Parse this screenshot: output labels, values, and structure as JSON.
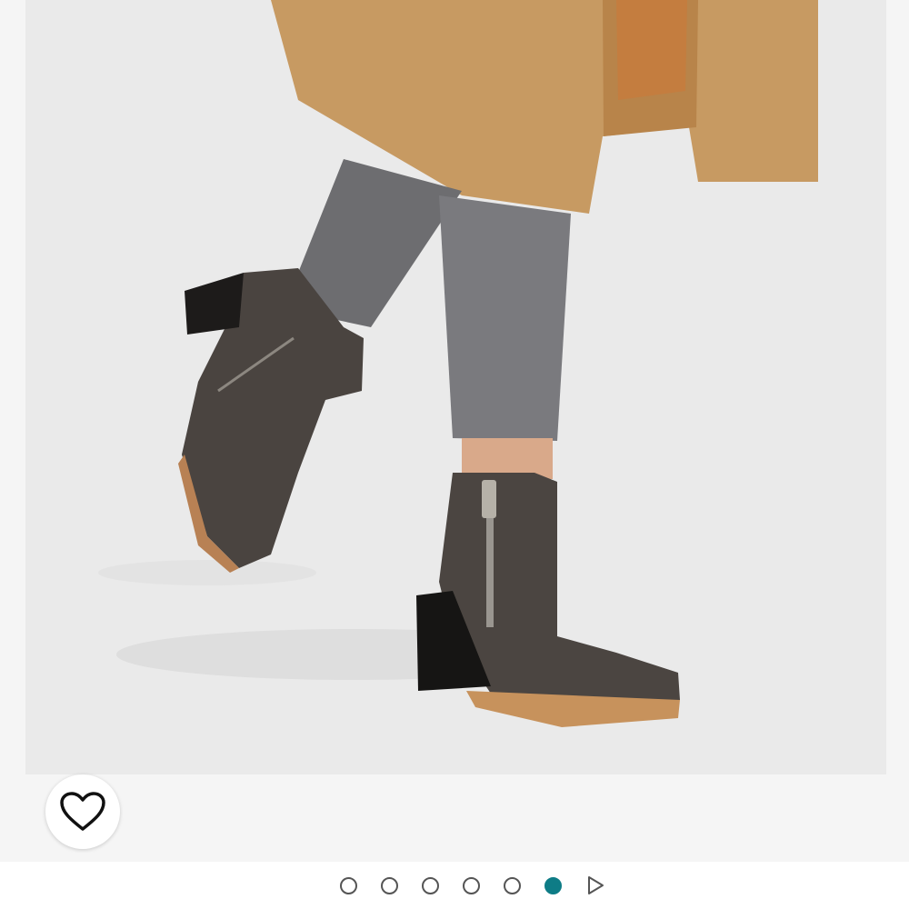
{
  "gallery": {
    "photo_alt": "",
    "favorite": {
      "icon": "heart-icon",
      "state": "not-favorited"
    },
    "pager": {
      "total_images": 6,
      "active_index": 5,
      "next_icon": "play-triangle-icon",
      "colors": {
        "active": "#0e7c86",
        "inactive_border": "#555555"
      }
    }
  }
}
